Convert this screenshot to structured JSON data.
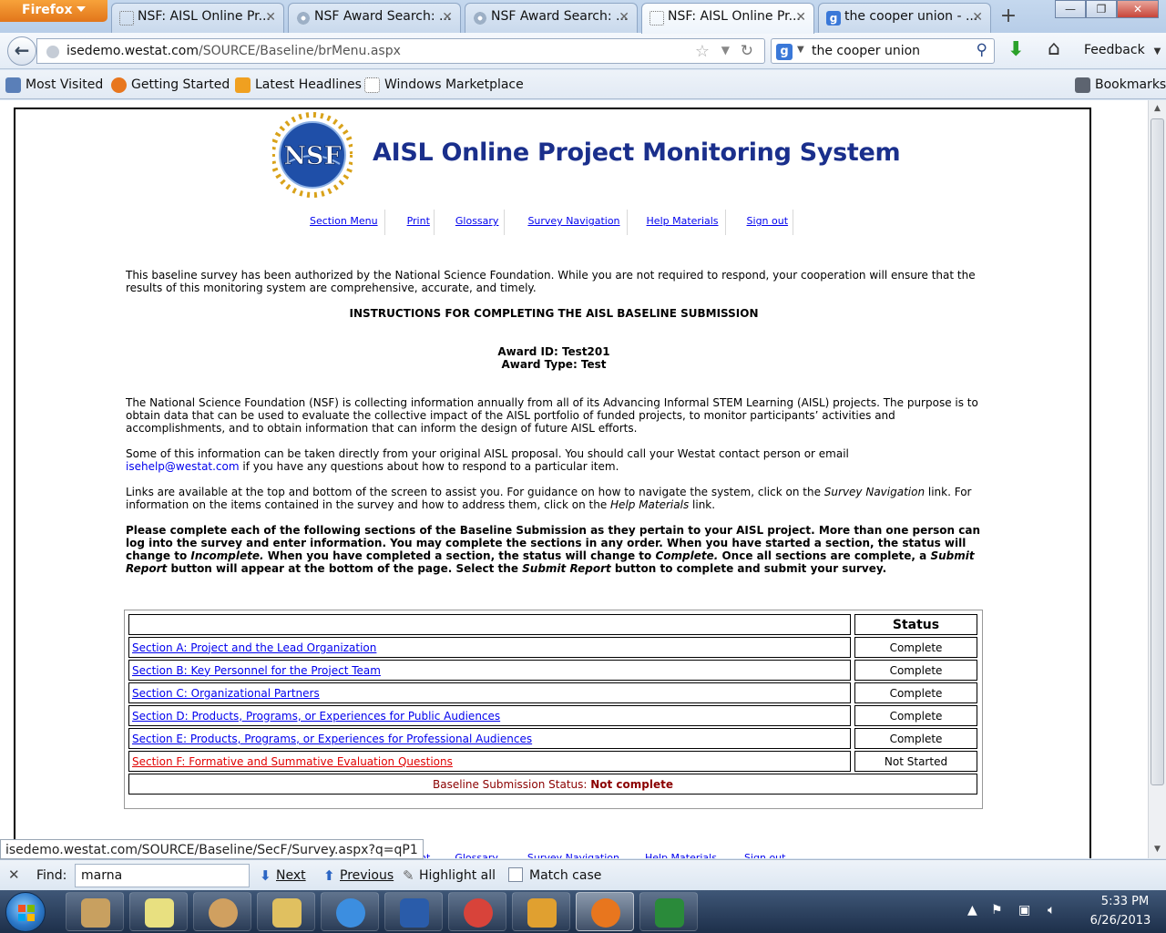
{
  "browser": {
    "menu_button": "Firefox",
    "tabs": [
      {
        "title": "NSF: AISL Online Pr...",
        "icon": "dotted-page-icon",
        "active": false
      },
      {
        "title": "NSF Award Search: ...",
        "icon": "gear-icon",
        "active": false
      },
      {
        "title": "NSF Award Search: ...",
        "icon": "gear-icon",
        "active": false
      },
      {
        "title": "NSF: AISL Online Pr...",
        "icon": "dotted-page-icon",
        "active": true
      },
      {
        "title": "the cooper union - ...",
        "icon": "google-icon",
        "active": false
      }
    ],
    "url_domain": "isedemo.westat.com",
    "url_path": "/SOURCE/Baseline/brMenu.aspx",
    "search_text": "the cooper union",
    "feedback_label": "Feedback",
    "bookmarks": [
      {
        "label": "Most Visited",
        "icon": "most-visited-icon",
        "color": "#5a7fb8"
      },
      {
        "label": "Getting Started",
        "icon": "firefox-icon",
        "color": "#e8761e"
      },
      {
        "label": "Latest Headlines",
        "icon": "rss-icon",
        "color": "#f0a020"
      },
      {
        "label": "Windows Marketplace",
        "icon": "dotted-page-icon",
        "color": "#ffffff"
      }
    ],
    "bookmarks_menu": "Bookmarks",
    "status_url": "isedemo.westat.com/SOURCE/Baseline/SecF/Survey.aspx?q=qP1"
  },
  "page": {
    "title": "AISL Online Project Monitoring System",
    "logo_text": "NSF",
    "nav_links": [
      "Section Menu",
      "Print",
      "Glossary",
      "Survey Navigation",
      "Help Materials",
      "Sign out"
    ],
    "intro": "This baseline survey has been authorized by the National Science Foundation. While you are not required to respond, your cooperation will ensure that the results of this monitoring system are comprehensive, accurate, and timely.",
    "instructions_heading": "INSTRUCTIONS FOR COMPLETING THE AISL BASELINE SUBMISSION",
    "award_id_line": "Award ID: Test201",
    "award_type_line": "Award Type: Test",
    "para1": "The National Science Foundation (NSF) is collecting information annually from all of its Advancing Informal STEM Learning (AISL) projects. The purpose is to obtain data that can be used to evaluate the collective impact of the AISL portfolio of funded projects, to monitor participants’ activities and accomplishments, and to obtain information that can inform the design of future AISL efforts.",
    "para2_before": "Some of this information can be taken directly from your original AISL proposal. You should call your Westat contact person or email",
    "para2_email": "isehelp@westat.com",
    "para2_after": " if you have any questions about how to respond to a particular item.",
    "para3_a": "Links are available at the top and bottom of the screen to assist you. For guidance on how to navigate the system, click on the ",
    "para3_b": "Survey Navigation",
    "para3_c": " link. For information on the items contained in the survey and how to address them, click on the ",
    "para3_d": "Help Materials",
    "para3_e": " link.",
    "bold_a": "Please complete each of the following sections of the Baseline Submission as they pertain to your AISL project. More than one person can log into the survey and enter information. You may complete the sections in any order. When you have started a section, the status will change to ",
    "bold_b": "Incomplete.",
    "bold_c": " When you have completed a section, the status will change to ",
    "bold_d": "Complete.",
    "bold_e": " Once all sections are complete, a ",
    "bold_f": "Submit Report",
    "bold_g": " button will appear at the bottom of the page. Select the ",
    "bold_h": "Submit Report",
    "bold_i": " button to complete and submit your survey.",
    "status_header": "Status",
    "sections": [
      {
        "label": "Section A: Project and the Lead Organization",
        "status": "Complete"
      },
      {
        "label": "Section B: Key Personnel for the Project Team",
        "status": "Complete"
      },
      {
        "label": "Section C: Organizational Partners",
        "status": "Complete"
      },
      {
        "label": "Section D: Products, Programs, or Experiences for Public Audiences",
        "status": "Complete"
      },
      {
        "label": "Section E: Products, Programs, or Experiences for Professional Audiences",
        "status": "Complete"
      },
      {
        "label": "Section F: Formative and Summative Evaluation Questions",
        "status": "Not Started"
      }
    ],
    "baseline_status_label": "Baseline Submission Status: ",
    "baseline_status_value": "Not complete"
  },
  "findbar": {
    "label": "Find:",
    "value": "marna",
    "next": "Next",
    "previous": "Previous",
    "highlight": "Highlight all",
    "match_case": "Match case"
  },
  "taskbar": {
    "apps": [
      {
        "icon": "task-scheduler-icon",
        "color": "#c8a060"
      },
      {
        "icon": "sticky-notes-icon",
        "color": "#e8e080"
      },
      {
        "icon": "paint-icon",
        "color": "#d0a060"
      },
      {
        "icon": "folder-icon",
        "color": "#e0c060"
      },
      {
        "icon": "internet-explorer-icon",
        "color": "#3c8ee0"
      },
      {
        "icon": "word-icon",
        "color": "#2a5caa"
      },
      {
        "icon": "chrome-icon",
        "color": "#d8433a"
      },
      {
        "icon": "outlook-icon",
        "color": "#e0a030"
      },
      {
        "icon": "firefox-icon",
        "color": "#e8761e"
      },
      {
        "icon": "excel-icon",
        "color": "#2a8a3a"
      }
    ],
    "time": "5:33 PM",
    "date": "6/26/2013"
  }
}
